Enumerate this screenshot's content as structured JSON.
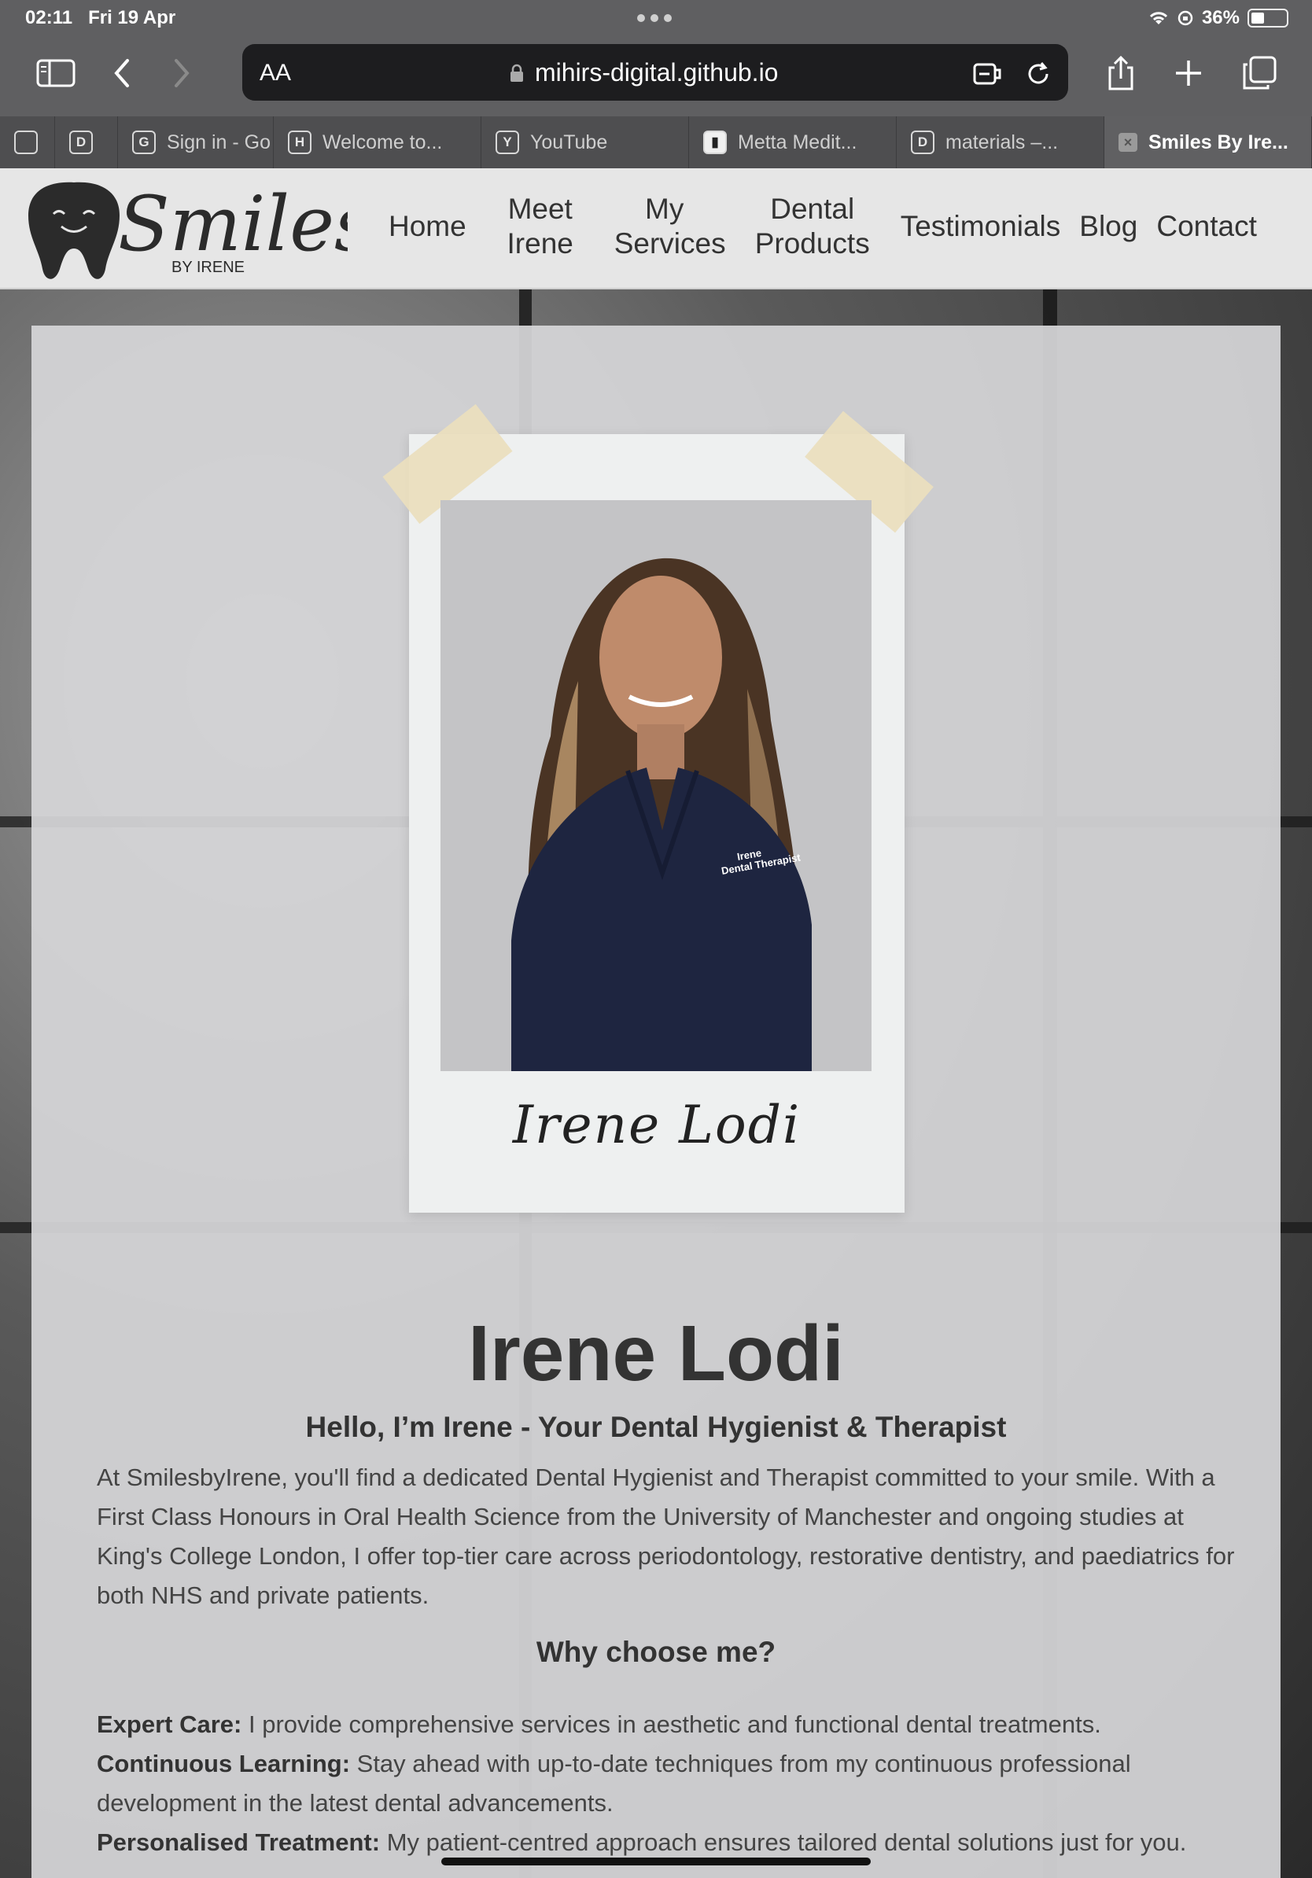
{
  "status_bar": {
    "time": "02:11",
    "date": "Fri 19 Apr",
    "battery": "36%",
    "battery_level": 0.36
  },
  "browser": {
    "aa_label": "AA",
    "url": "mihirs-digital.github.io",
    "tabs": [
      {
        "favicon": "",
        "title": ""
      },
      {
        "favicon": "D",
        "title": ""
      },
      {
        "favicon": "G",
        "title": "Sign in - Go"
      },
      {
        "favicon": "H",
        "title": "Welcome to..."
      },
      {
        "favicon": "Y",
        "title": "YouTube"
      },
      {
        "favicon": "",
        "title": "Metta Medit..."
      },
      {
        "favicon": "D",
        "title": "materials –..."
      },
      {
        "favicon": "×",
        "title": "Smiles By Ire..."
      }
    ]
  },
  "site": {
    "logo": {
      "name": "Smiles",
      "tagline": "BY IRENE"
    },
    "nav": [
      {
        "label": "Home"
      },
      {
        "label": "Meet Irene"
      },
      {
        "label": "My Services"
      },
      {
        "label": "Dental Products"
      },
      {
        "label": "Testimonials"
      },
      {
        "label": "Blog"
      },
      {
        "label": "Contact"
      }
    ]
  },
  "profile": {
    "signature": "Irene Lodi",
    "name": "Irene Lodi",
    "subtitle": "Hello, I’m Irene - Your Dental Hygienist & Therapist",
    "intro": "At SmilesbyIrene, you'll find a dedicated Dental Hygienist and Therapist committed to your smile. With a First Class Honours in Oral Health Science from the University of Manchester and ongoing studies at King's College London, I offer top-tier care across periodontology, restorative dentistry, and paediatrics for both NHS and private patients.",
    "why_heading": "Why choose me?",
    "reasons": [
      {
        "title": "Expert Care:",
        "text": " I provide comprehensive services in aesthetic and functional dental treatments."
      },
      {
        "title": "Continuous Learning:",
        "text": " Stay ahead with up-to-date techniques from my continuous professional development in the latest dental advancements."
      },
      {
        "title": "Personalised Treatment:",
        "text": " My patient-centred approach ensures tailored dental solutions just for you."
      }
    ],
    "scrub_text_1": "Irene",
    "scrub_text_2": "Dental Therapist"
  }
}
